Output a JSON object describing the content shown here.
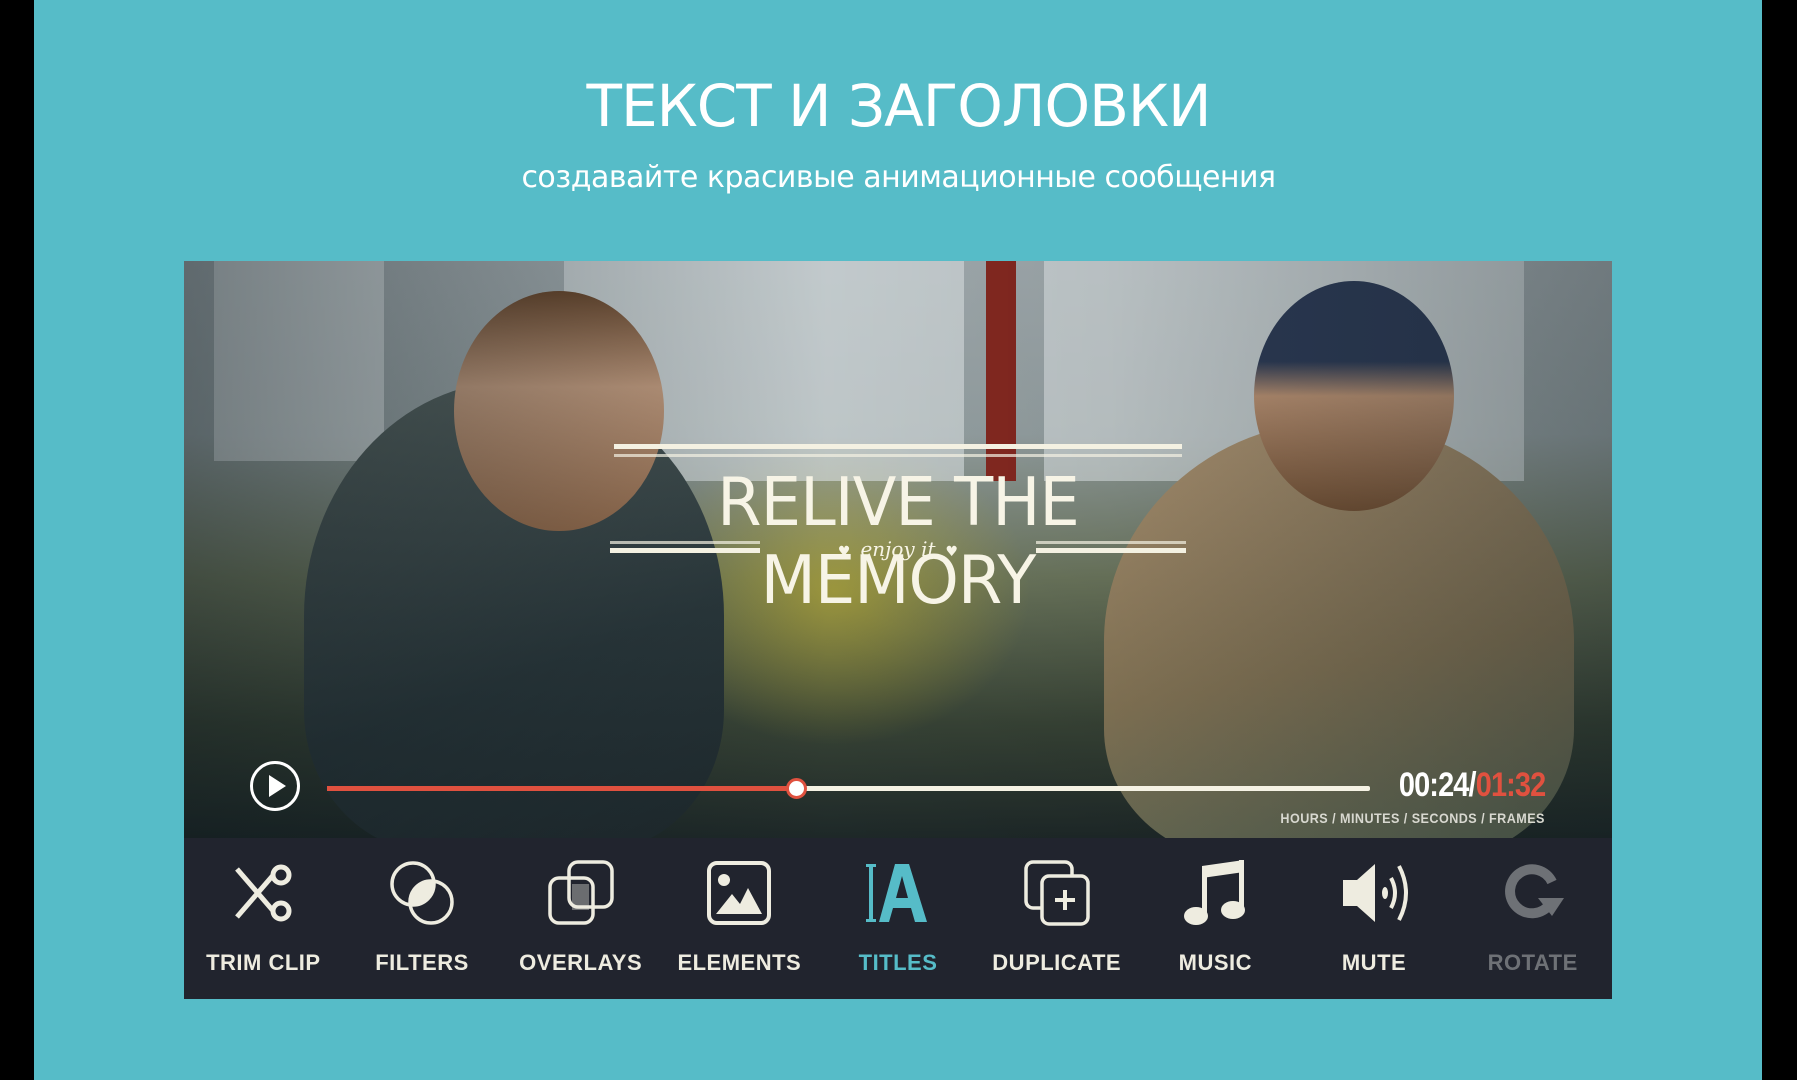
{
  "header": {
    "title": "ТЕКСТ И ЗАГОЛОВКИ",
    "subtitle": "создавайте красивые анимационные сообщения"
  },
  "colors": {
    "background": "#56bcc8",
    "accent": "#56bcc8",
    "progress": "#e0513f",
    "toolbar": "#21242e"
  },
  "video": {
    "title_overlay": "RELIVE THE MEMORY",
    "subtitle_overlay": "enjoy it",
    "player": {
      "play_icon": "play-icon",
      "current_time": "00:24",
      "separator": "/",
      "duration": "01:32",
      "time_format_label": "HOURS / MINUTES / SECONDS / FRAMES",
      "progress_fraction": 0.45
    }
  },
  "toolbar": {
    "items": [
      {
        "label": "TRIM CLIP",
        "icon": "scissors-icon",
        "state": "normal"
      },
      {
        "label": "FILTERS",
        "icon": "filters-icon",
        "state": "normal"
      },
      {
        "label": "OVERLAYS",
        "icon": "overlays-icon",
        "state": "normal"
      },
      {
        "label": "ELEMENTS",
        "icon": "image-icon",
        "state": "normal"
      },
      {
        "label": "TITLES",
        "icon": "text-titles-icon",
        "state": "active"
      },
      {
        "label": "DUPLICATE",
        "icon": "duplicate-icon",
        "state": "normal"
      },
      {
        "label": "MUSIC",
        "icon": "music-note-icon",
        "state": "normal"
      },
      {
        "label": "MUTE",
        "icon": "speaker-icon",
        "state": "normal"
      },
      {
        "label": "ROTATE",
        "icon": "rotate-icon",
        "state": "disabled"
      }
    ]
  }
}
